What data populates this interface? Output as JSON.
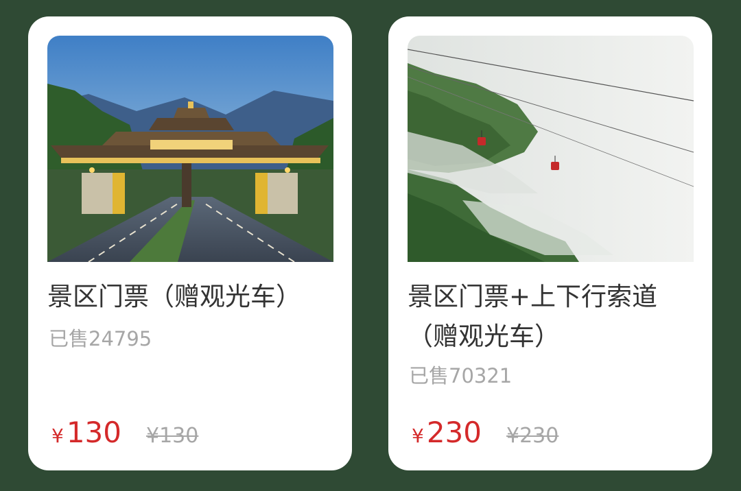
{
  "products": [
    {
      "title": "景区门票（赠观光车）",
      "sold": "已售24795",
      "currency": "¥",
      "price": "130",
      "original_price": "¥130",
      "image": "scenic-gate-photo"
    },
    {
      "title": "景区门票+上下行索道（赠观光车）",
      "sold": "已售70321",
      "currency": "¥",
      "price": "230",
      "original_price": "¥230",
      "image": "misty-mountain-cable-car-photo"
    }
  ],
  "colors": {
    "background": "#2f4a34",
    "card": "#ffffff",
    "price": "#d4292a",
    "muted": "#a6a6a6",
    "title": "#333333"
  }
}
